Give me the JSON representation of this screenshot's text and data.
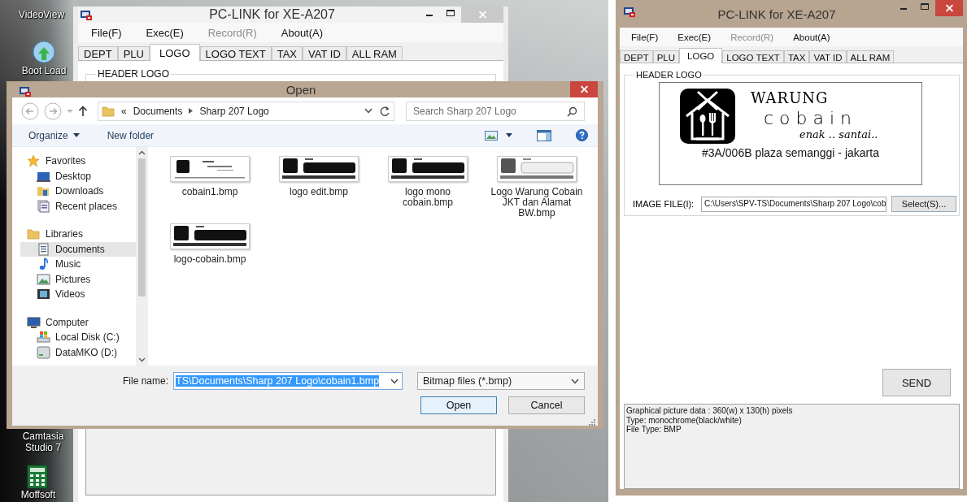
{
  "desktop": {
    "icons": [
      {
        "label": "VideoView",
        "kind": "none"
      },
      {
        "label": "Boot Load",
        "kind": "upload"
      },
      {
        "label": "Camtasia Studio 7",
        "kind": "none"
      },
      {
        "label": "Moffsoft",
        "kind": "calculator"
      }
    ]
  },
  "background_window": {
    "title": "PC-LINK for XE-A207",
    "menu": [
      {
        "label": "File(F)",
        "disabled": false
      },
      {
        "label": "Exec(E)",
        "disabled": false
      },
      {
        "label": "Record(R)",
        "disabled": true
      },
      {
        "label": "About(A)",
        "disabled": false
      }
    ],
    "tabs": [
      {
        "label": "DEPT",
        "selected": false
      },
      {
        "label": "PLU",
        "selected": false
      },
      {
        "label": "LOGO",
        "selected": true
      },
      {
        "label": "LOGO TEXT",
        "selected": false
      },
      {
        "label": "TAX",
        "selected": false
      },
      {
        "label": "VAT ID",
        "selected": false
      },
      {
        "label": "ALL RAM",
        "selected": false
      }
    ],
    "group_title": "HEADER LOGO"
  },
  "open_dialog": {
    "title": "Open",
    "breadcrumb": [
      "«",
      "Documents",
      "Sharp 207 Logo"
    ],
    "search": {
      "placeholder": "Search Sharp 207 Logo"
    },
    "toolbar": [
      {
        "label": "Organize",
        "dropdown": true
      },
      {
        "label": "New folder",
        "dropdown": false
      }
    ],
    "nav": [
      {
        "label": "Favorites",
        "kind": "favorites",
        "selected": false,
        "children": [
          {
            "label": "Desktop",
            "kind": "desktop",
            "selected": false
          },
          {
            "label": "Downloads",
            "kind": "downloads",
            "selected": false
          },
          {
            "label": "Recent places",
            "kind": "recent",
            "selected": false
          }
        ]
      },
      {
        "label": "Libraries",
        "kind": "libraries",
        "selected": false,
        "children": [
          {
            "label": "Documents",
            "kind": "documents",
            "selected": true
          },
          {
            "label": "Music",
            "kind": "music",
            "selected": false
          },
          {
            "label": "Pictures",
            "kind": "pictures",
            "selected": false
          },
          {
            "label": "Videos",
            "kind": "videos",
            "selected": false
          }
        ]
      },
      {
        "label": "Computer",
        "kind": "computer",
        "selected": false,
        "children": [
          {
            "label": "Local Disk (C:)",
            "kind": "disk",
            "selected": false
          },
          {
            "label": "DataMKO (D:)",
            "kind": "drive",
            "selected": false
          }
        ]
      }
    ],
    "files": [
      {
        "name": "cobain1.bmp",
        "kind": "light"
      },
      {
        "name": "logo edit.bmp",
        "kind": "bold"
      },
      {
        "name": "logo mono cobain.bmp",
        "kind": "bold"
      },
      {
        "name": "Logo Warung Cobain JKT dan Alamat BW.bmp",
        "kind": "faded"
      },
      {
        "name": "logo-cobain.bmp",
        "kind": "bold"
      }
    ],
    "file_name": {
      "label": "File name:",
      "value": "TS\\Documents\\Sharp 207 Logo\\cobain1.bmp",
      "selected": true
    },
    "file_type": "Bitmap files (*.bmp)",
    "buttons": [
      "Open",
      "Cancel"
    ]
  },
  "main_window": {
    "title": "PC-LINK for XE-A207",
    "menu": [
      {
        "label": "File(F)",
        "disabled": false
      },
      {
        "label": "Exec(E)",
        "disabled": false
      },
      {
        "label": "Record(R)",
        "disabled": true
      },
      {
        "label": "About(A)",
        "disabled": false
      }
    ],
    "tabs": [
      {
        "label": "DEPT",
        "selected": false
      },
      {
        "label": "PLU",
        "selected": false
      },
      {
        "label": "LOGO",
        "selected": true
      },
      {
        "label": "LOGO TEXT",
        "selected": false
      },
      {
        "label": "TAX",
        "selected": false
      },
      {
        "label": "VAT ID",
        "selected": false
      },
      {
        "label": "ALL RAM",
        "selected": false
      }
    ],
    "group_title": "HEADER LOGO",
    "logo_preview": {
      "lines": [
        "WARUNG",
        "cobain",
        "enak .. santai..",
        "#3A/006B plaza semanggi - jakarta"
      ]
    },
    "image_file": {
      "label": "IMAGE FILE(I):",
      "value": "C:\\Users\\SPV-TS\\Documents\\Sharp 207 Logo\\cob"
    },
    "select_button": "Select(S)...",
    "send_button": "SEND",
    "info": [
      "Graphical picture data : 360(w) x 130(h) pixels",
      "Type: monochrome(black/white)",
      "File Type: BMP"
    ]
  }
}
